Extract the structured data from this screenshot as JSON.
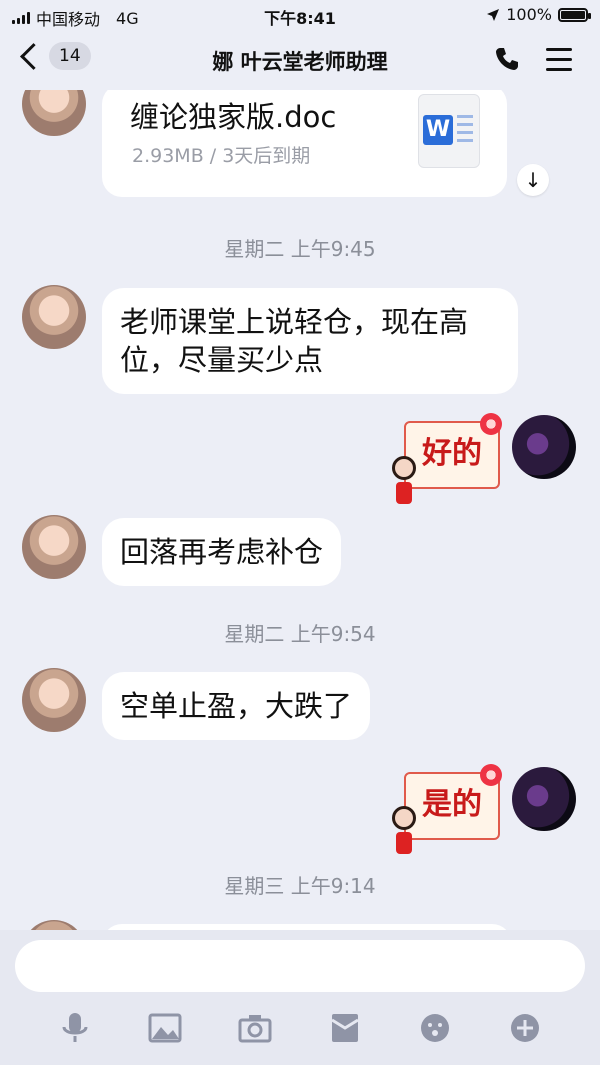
{
  "status_bar": {
    "carrier": "中国移动",
    "network": "4G",
    "time": "下午8:41",
    "battery": "100%"
  },
  "nav": {
    "back_count": "14",
    "title": "娜 叶云堂老师助理"
  },
  "file_message": {
    "name": "缠论独家版.doc",
    "meta": "2.93MB / 3天后到期",
    "icon": "word-doc-icon"
  },
  "timestamps": [
    "星期二 上午9:45",
    "星期二 上午9:54",
    "星期三 上午9:14"
  ],
  "messages": [
    {
      "from": "other",
      "text": "老师课堂上说轻仓，现在高位，尽量买少点"
    },
    {
      "from": "self",
      "sticker": "好的"
    },
    {
      "from": "other",
      "text": "回落再考虑补仓"
    },
    {
      "from": "other",
      "text": "空单止盈，大跌了"
    },
    {
      "from": "self",
      "sticker": "是的"
    }
  ],
  "toolbar": {
    "icons": [
      "microphone-icon",
      "image-icon",
      "camera-icon",
      "red-packet-icon",
      "emoji-icon",
      "plus-icon"
    ]
  },
  "colors": {
    "background": "#eceef6",
    "bubble": "#ffffff",
    "timestamp": "#8b8f99",
    "sticker_text": "#c81a1a"
  }
}
